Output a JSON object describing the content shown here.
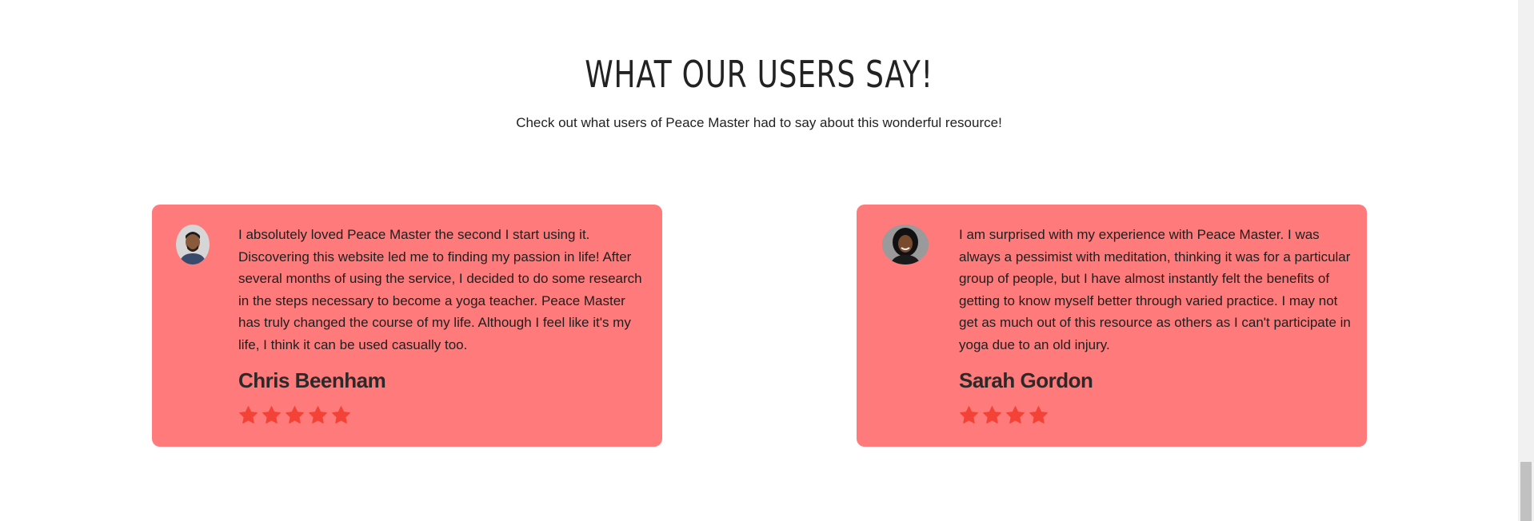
{
  "section": {
    "title": "WHAT OUR USERS SAY!",
    "subtitle": "Check out what users of Peace Master had to say about this wonderful resource!"
  },
  "testimonials": [
    {
      "quote": "I absolutely loved Peace Master the second I start using it. Discovering this website led me to finding my passion in life! After several months of using the service, I decided to do some research in the steps necessary to become a yoga teacher. Peace Master has truly changed the course of my life. Although I feel like it's my life, I think it can be used casually too.",
      "name": "Chris Beenham",
      "rating": 5,
      "avatar_icon": "person-avatar-icon"
    },
    {
      "quote": "I am surprised with my experience with Peace Master. I was always a pessimist with meditation, thinking it was for a particular group of people, but I have almost instantly felt the benefits of getting to know myself better through varied practice. I may not get as much out of this resource as others as I can't participate in yoga due to an old injury.",
      "name": "Sarah Gordon",
      "rating": 4,
      "avatar_icon": "person-avatar-icon"
    }
  ],
  "colors": {
    "card_background": "#ff7a7a",
    "star": "#f44336",
    "heading_text": "#222222"
  }
}
